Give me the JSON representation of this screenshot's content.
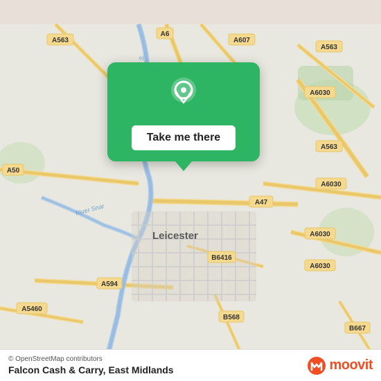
{
  "map": {
    "background_color": "#e8e0d8",
    "center": "Leicester, East Midlands"
  },
  "popup": {
    "button_label": "Take me there",
    "icon_color": "white",
    "background_color": "#2db563"
  },
  "bottom_bar": {
    "osm_credit": "© OpenStreetMap contributors",
    "place_name": "Falcon Cash & Carry,",
    "place_region": "East Midlands",
    "moovit_label": "moovit"
  },
  "road_labels": [
    "A563",
    "A6",
    "A607",
    "A563",
    "A6030",
    "A50",
    "A47",
    "A6030",
    "A563",
    "A594",
    "A5460",
    "B6416",
    "B568",
    "B667",
    "A6030"
  ],
  "city_label": "Leicester"
}
